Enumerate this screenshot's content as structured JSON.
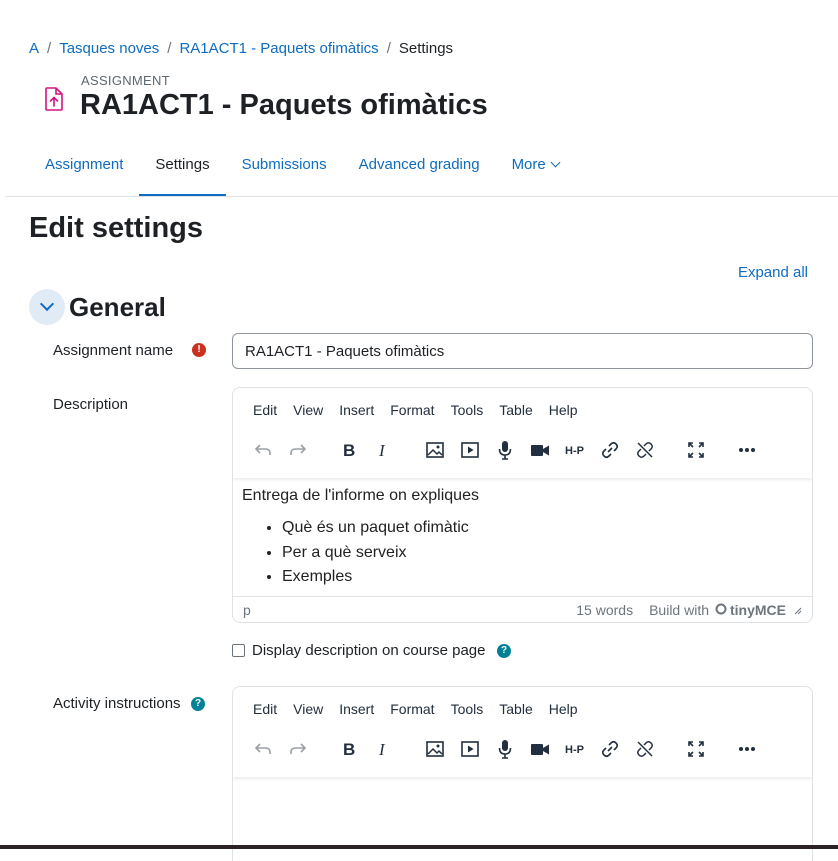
{
  "breadcrumb": {
    "items": [
      "A",
      "Tasques noves",
      "RA1ACT1 - Paquets ofimàtics"
    ],
    "current": "Settings",
    "separator": "/"
  },
  "header": {
    "module_type": "ASSIGNMENT",
    "title": "RA1ACT1 - Paquets ofimàtics",
    "icon": "assignment-upload-icon"
  },
  "tabs": [
    {
      "label": "Assignment",
      "active": false
    },
    {
      "label": "Settings",
      "active": true
    },
    {
      "label": "Submissions",
      "active": false
    },
    {
      "label": "Advanced grading",
      "active": false
    },
    {
      "label": "More",
      "active": false
    }
  ],
  "page": {
    "heading": "Edit settings",
    "expand_all": "Expand all"
  },
  "general": {
    "title": "General",
    "assignment_name_label": "Assignment name",
    "assignment_name_value": "RA1ACT1 - Paquets ofimàtics",
    "description_label": "Description",
    "display_description_label": "Display description on course page",
    "activity_instructions_label": "Activity instructions"
  },
  "editor": {
    "menu": [
      "Edit",
      "View",
      "Insert",
      "Format",
      "Tools",
      "Table",
      "Help"
    ],
    "description_text": "Entrega de l'informe on expliques",
    "description_items": [
      "Què és un paquet ofimàtic",
      "Per a què serveix",
      "Exemples"
    ],
    "status_path": "p",
    "word_count": "15 words",
    "build_with": "Build with",
    "brand": "tinyMCE"
  },
  "colors": {
    "link": "#0f6cbf",
    "required": "#ca3120",
    "help": "#008196",
    "accent_icon": "#d6127f"
  }
}
